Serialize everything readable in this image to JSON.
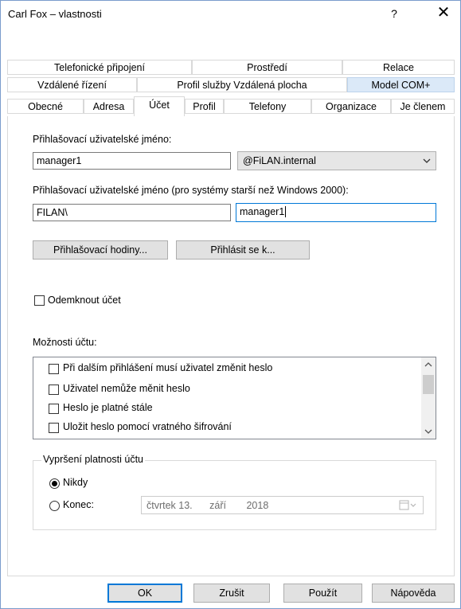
{
  "window": {
    "title": "Carl Fox – vlastnosti",
    "help_label": "?",
    "close_label": "✕"
  },
  "tabs": {
    "row1": [
      "Telefonické připojení",
      "Prostředí",
      "Relace"
    ],
    "row2": [
      "Vzdálené řízení",
      "Profil služby Vzdálená plocha",
      "Model COM+"
    ],
    "row3": [
      "Obecné",
      "Adresa",
      "Účet",
      "Profil",
      "Telefony",
      "Organizace",
      "Je členem"
    ]
  },
  "account": {
    "upn_label": "Přihlašovací uživatelské jméno:",
    "upn_value": "manager1",
    "domain_suffix": "@FiLAN.internal",
    "legacy_label": "Přihlašovací uživatelské jméno (pro systémy starší než Windows 2000):",
    "legacy_domain": "FILAN\\",
    "legacy_value": "manager1",
    "logon_hours_label": "Přihlašovací hodiny...",
    "log_on_to_label": "Přihlásit se k...",
    "unlock_label": "Odemknout účet"
  },
  "options": {
    "label": "Možnosti účtu:",
    "items": [
      "Při dalším přihlášení musí uživatel změnit heslo",
      "Uživatel nemůže měnit heslo",
      "Heslo je platné stále",
      "Uložit heslo pomocí vratného šifrování"
    ]
  },
  "expiry": {
    "title": "Vypršení platnosti účtu",
    "never_label": "Nikdy",
    "end_label": "Konec:",
    "date_day": "čtvrtek 13.",
    "date_month": "září",
    "date_year": "2018",
    "selected": "Nikdy"
  },
  "footer": {
    "ok": "OK",
    "cancel": "Zrušit",
    "apply": "Použít",
    "help": "Nápověda"
  },
  "colors": {
    "accent": "#0078d7",
    "tab_selected": "#dbe9f8",
    "button_face": "#e1e1e1"
  }
}
